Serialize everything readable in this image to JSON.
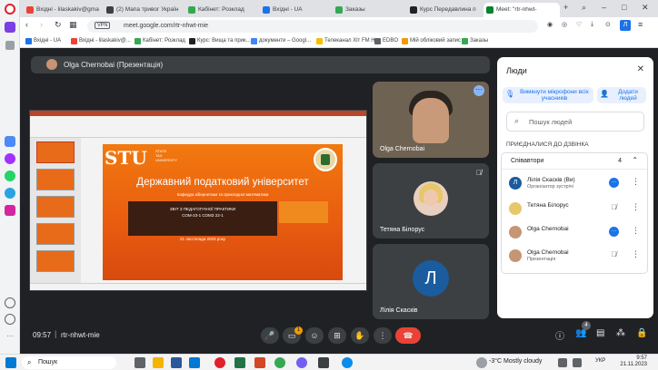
{
  "browser": {
    "tabs": [
      {
        "label": "Вхідні - lilaskakiv@gma",
        "color": "#ea4335"
      },
      {
        "label": "(2) Мапа тривог Україн",
        "color": "#3c4043"
      },
      {
        "label": "Кабінет: Розклад",
        "color": "#34a853"
      },
      {
        "label": "Вхідні - UA",
        "color": "#1a73e8"
      },
      {
        "label": "Заказы",
        "color": "#34a853"
      },
      {
        "label": "Курс Передавлина п",
        "color": "#202124"
      },
      {
        "label": "Meet: \"rtr-nhwt-",
        "color": "#00832d"
      }
    ],
    "url": "meet.google.com/rtr-nhwt-mie",
    "vpn_label": "VPN",
    "bookmarks": [
      {
        "label": "Вхідні - UA",
        "color": "#1a73e8"
      },
      {
        "label": "Вхідні - lilaskakiv@...",
        "color": "#ea4335"
      },
      {
        "label": "Кабінет: Розклад",
        "color": "#34a853"
      },
      {
        "label": "Курс: Вища та прик...",
        "color": "#202124"
      },
      {
        "label": "документи – Googl...",
        "color": "#4285f4"
      },
      {
        "label": "Телеканал Хіт FM Н...",
        "color": "#fbbc04"
      },
      {
        "label": "EDBO",
        "color": "#5f6368"
      },
      {
        "label": "Мій обліковий запис",
        "color": "#f29900"
      },
      {
        "label": "Заказы",
        "color": "#34a853"
      }
    ]
  },
  "meet": {
    "presenter_label": "Olga Chernobai (Презентація)",
    "slide": {
      "logo": "STU",
      "logo_sub_1": "STATE",
      "logo_sub_2": "TAX",
      "logo_sub_3": "UNIVERSITY",
      "university": "Державний податковий університет",
      "department": "Кафедра кібернетики та прикладної математики",
      "report_line_1": "ЗВІТ З ПЕДАГОГІЧНОЇ ПРАКТИКИ",
      "report_line_2": "СОМ-23-1  СОМЗ 22-1",
      "date": "21 листопада 2023 року"
    },
    "tiles": [
      {
        "name": "Olga Chernobai"
      },
      {
        "name": "Тетяна Білорус"
      },
      {
        "name": "Лілія Скаскiв",
        "initial": "Л"
      }
    ],
    "controls": {
      "time": "09:57",
      "separator": "|",
      "code": "rtr-nhwt-mie",
      "hand_badge": "1",
      "people_count": "4"
    }
  },
  "people_panel": {
    "title": "Люди",
    "mute_all": "Вимкнути мікрофони всіх учасників",
    "add_people": "Додати людей",
    "search_placeholder": "Пошук людей",
    "section_label": "ПРИЄДНАЛИСЯ ДО ДЗВІНКА",
    "group_label": "Співавтори",
    "group_count": "4",
    "participants": [
      {
        "name": "Лілія Скаскiв (Ви)",
        "role": "Організатор зустрічі",
        "initial": "Л",
        "status": "active"
      },
      {
        "name": "Тетяна Білорус",
        "role": "",
        "initial": "",
        "status": "muted"
      },
      {
        "name": "Olga Chernobai",
        "role": "",
        "initial": "",
        "status": "active"
      },
      {
        "name": "Olga Chernobai",
        "role": "Презентація",
        "initial": "",
        "status": "muted"
      }
    ]
  },
  "taskbar": {
    "search": "Пошук",
    "weather": "-3°C  Mostly cloudy",
    "lang": "УКР",
    "time": "9:57",
    "date": "21.11.2023"
  }
}
